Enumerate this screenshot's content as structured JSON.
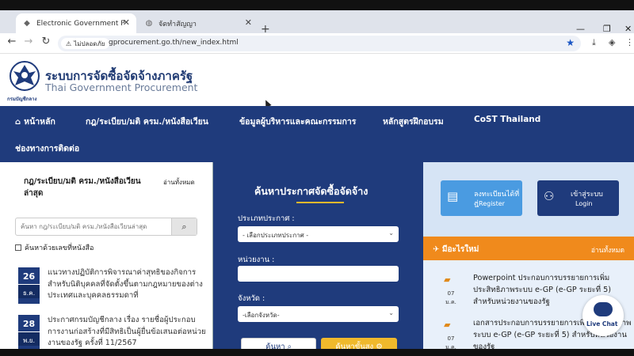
{
  "browser": {
    "tabs": [
      {
        "title": "Electronic Government Procurem",
        "active": true
      },
      {
        "title": "จัดทำสัญญา",
        "active": false
      }
    ],
    "not_secure_label": "ไม่ปลอดภัย",
    "url": "gprocurement.go.th/new_index.html"
  },
  "site": {
    "name_th": "ระบบการจัดซื้อจัดจ้างภาครัฐ",
    "name_en": "Thai Government Procurement",
    "logo_caption": "กรมบัญชีกลาง"
  },
  "nav": {
    "items": [
      "หน้าหลัก",
      "กฎ/ระเบียบ/มติ ครม./หนังสือเวียน",
      "ข้อมูลผู้บริหารและคณะกรรมการ",
      "หลักสูตรฝึกอบรม",
      "CoST Thailand",
      "ช่องทางการติดต่อ"
    ]
  },
  "left": {
    "title": "กฎ/ระเบียบ/มติ ครม./หนังสือเวียนล่าสุด",
    "read_all": "อ่านทั้งหมด",
    "search_placeholder": "ค้นหา กฎ/ระเบียบ/มติ ครม./หนังสือเวียนล่าสุด",
    "checkbox_label": "ค้นหาด้วยเลขที่หนังสือ",
    "news": [
      {
        "day": "26",
        "month": "ธ.ค.",
        "text": "แนวทางปฏิบัติการพิจารณาค่าสุทธิของกิจการสำหรับนิติบุคคลที่จัดตั้งขึ้นตามกฎหมายของต่างประเทศและบุคคลธรรมดาที่"
      },
      {
        "day": "28",
        "month": "พ.ย.",
        "text": "ประกาศกรมบัญชีกลาง เรื่อง รายชื่อผู้ประกอบการงานก่อสร้างที่มีสิทธิเป็นผู้ยื่นข้อเสนอต่อหน่วยงานของรัฐ ครั้งที่ 11/2567"
      }
    ]
  },
  "middle": {
    "title": "ค้นหาประกาศจัดซื้อจัดจ้าง",
    "type_label": "ประเภทประกาศ :",
    "type_value": "- เลือกประเภทประกาศ -",
    "agency_label": "หน่วยงาน :",
    "agency_value": "",
    "province_label": "จังหวัด :",
    "province_value": "-เลือกจังหวัด-",
    "search_button": "ค้นหา",
    "advanced_button": "ค้นหาขั้นสูง"
  },
  "right": {
    "register_th": "ลงทะเบียนได้ที่นี่",
    "register_en": "Register",
    "login_th": "เข้าสู่ระบบ",
    "login_en": "Login",
    "whats_new": "มีอะไรใหม่",
    "read_all": "อ่านทั้งหมด",
    "announcements": [
      {
        "date": "07 ม.ค.",
        "text": "Powerpoint ประกอบการบรรยายการเพิ่มประสิทธิภาพระบบ e-GP (e-GP ระยะที่ 5) สำหรับหน่วยงานของรัฐ"
      },
      {
        "date": "07 ม.ค.",
        "text": "เอกสารประกอบการบรรยายการเพิ่มประสิทธิภาพระบบ e-GP (e-GP ระยะที่ 5) สำหรับหน่วยงานของรัฐ"
      }
    ]
  },
  "chat": {
    "label": "Live Chat"
  },
  "colors": {
    "primary": "#1f3b7c",
    "accent": "#f0b92c",
    "orange": "#f08a1c",
    "light_blue": "#4a9be1"
  }
}
